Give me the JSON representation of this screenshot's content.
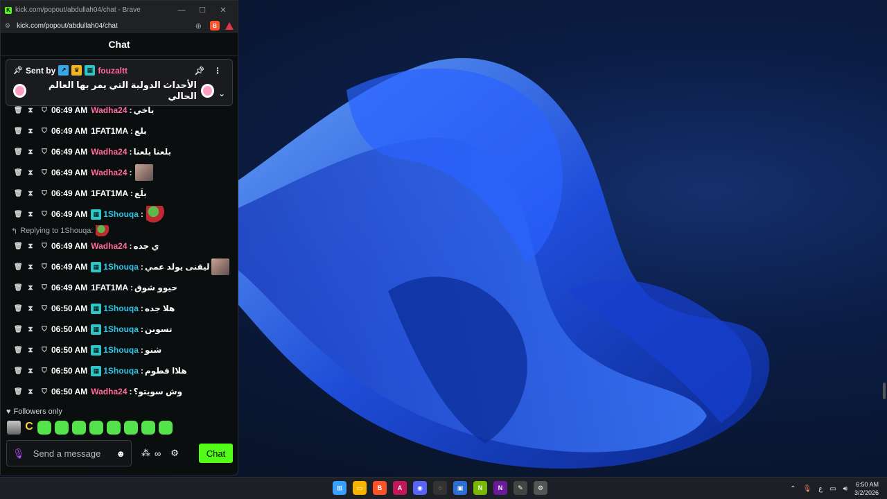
{
  "window": {
    "title": "kick.com/popout/abdullah04/chat - Brave",
    "url": "kick.com/popout/abdullah04/chat"
  },
  "chat": {
    "header": "Chat",
    "pinned": {
      "sent_by_label": "Sent by",
      "username": "fouzaltt",
      "message": "الأحداث الدولية التي يمر بها العالم الحالي"
    },
    "reply_label": "Replying to 1Shouqa:",
    "messages": [
      {
        "time": "06:49 AM",
        "user": "Wadha24",
        "color": "pink",
        "badge": false,
        "text": "ياخي",
        "emote": ""
      },
      {
        "time": "06:49 AM",
        "user": "1FAT1MA",
        "color": "white",
        "badge": false,
        "text": "بلع",
        "emote": ""
      },
      {
        "time": "06:49 AM",
        "user": "Wadha24",
        "color": "pink",
        "badge": false,
        "text": "بلعنا بلعنا",
        "emote": ""
      },
      {
        "time": "06:49 AM",
        "user": "Wadha24",
        "color": "pink",
        "badge": false,
        "text": "",
        "emote": "face"
      },
      {
        "time": "06:49 AM",
        "user": "1FAT1MA",
        "color": "white",
        "badge": false,
        "text": "بلَع",
        "emote": ""
      },
      {
        "time": "06:49 AM",
        "user": "1Shouqa",
        "color": "cyan",
        "badge": true,
        "text": "",
        "emote": "frog"
      },
      {
        "time": "06:49 AM",
        "user": "Wadha24",
        "color": "pink",
        "badge": false,
        "text": "ي جده",
        "emote": ""
      },
      {
        "time": "06:49 AM",
        "user": "1Shouqa",
        "color": "cyan",
        "badge": true,
        "text": "ليقنى يولد عمي",
        "emote": "face"
      },
      {
        "time": "06:49 AM",
        "user": "1FAT1MA",
        "color": "white",
        "badge": false,
        "text": "حيوو شوق",
        "emote": ""
      },
      {
        "time": "06:50 AM",
        "user": "1Shouqa",
        "color": "cyan",
        "badge": true,
        "text": "هلا جده",
        "emote": ""
      },
      {
        "time": "06:50 AM",
        "user": "1Shouqa",
        "color": "cyan",
        "badge": true,
        "text": "تسوىن",
        "emote": ""
      },
      {
        "time": "06:50 AM",
        "user": "1Shouqa",
        "color": "cyan",
        "badge": true,
        "text": "شنو",
        "emote": ""
      },
      {
        "time": "06:50 AM",
        "user": "1Shouqa",
        "color": "cyan",
        "badge": true,
        "text": "هلاا فطوم",
        "emote": ""
      },
      {
        "time": "06:50 AM",
        "user": "Wadha24",
        "color": "pink",
        "badge": false,
        "text": "وش سويتو؟",
        "emote": ""
      }
    ],
    "followers_only": "Followers only",
    "input_placeholder": "Send a message",
    "send_button": "Chat"
  },
  "taskbar": {
    "time": "6:50 AM",
    "date": "3/2/2026",
    "lang": "ع"
  }
}
